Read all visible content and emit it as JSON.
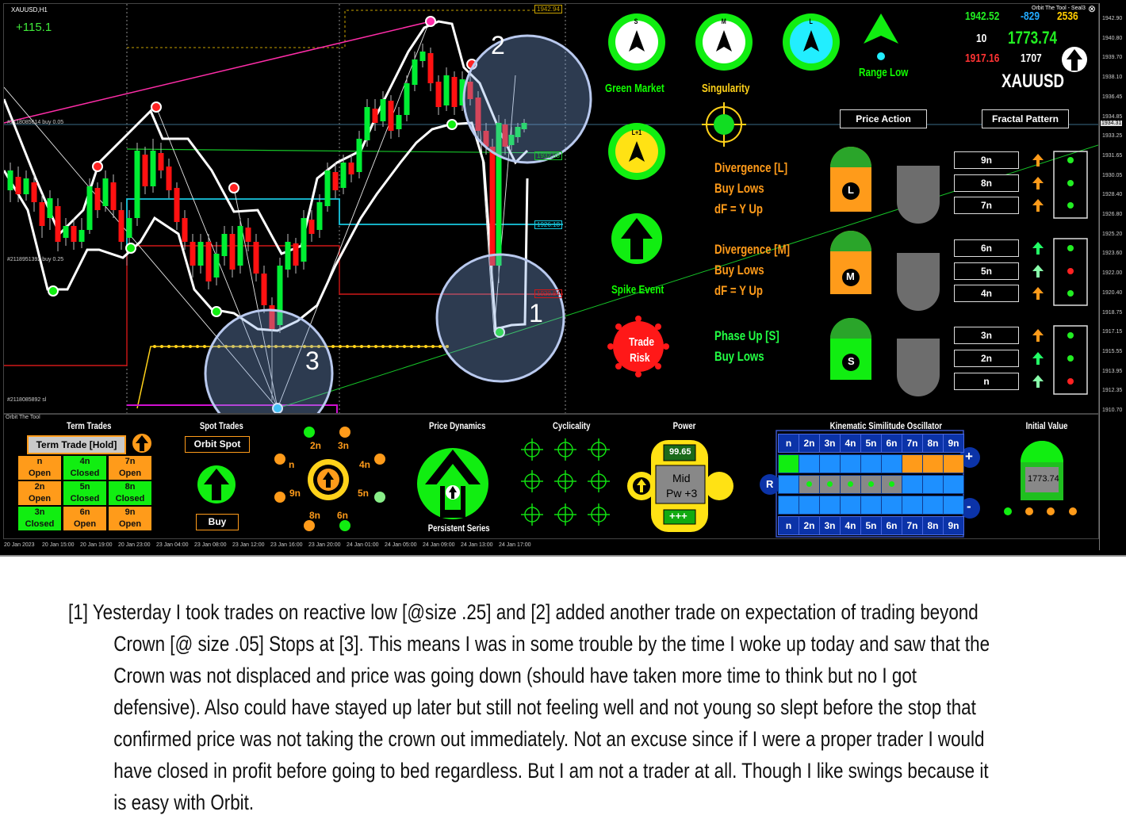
{
  "window": {
    "title": "XAUUSD,H1",
    "profit": "+115.1",
    "indicator_name": "Orbit The Tool - Seal3",
    "close_glyph": "⊗"
  },
  "orders": {
    "buy_05": "#2118085614 buy 0.05",
    "buy_25": "#2118951392 buy 0.25",
    "sl": "#2118085892 sl"
  },
  "level_tags": {
    "top": "1942.94",
    "mid1": "1932.58",
    "cyan": "1926.18",
    "red": "1920.84",
    "bid": "1934.31"
  },
  "chart_numbers": [
    "1",
    "2",
    "3"
  ],
  "signals": {
    "s_dial": "S",
    "m_dial": "M",
    "l_dial": "L",
    "lplus_dial": "L+1",
    "green_market": "Green Market",
    "singularity": "Singularity",
    "range_low": "Range Low",
    "spike_event": "Spike Event",
    "trade_risk_line1": "Trade",
    "trade_risk_line2": "Risk"
  },
  "quote": {
    "v1": "1942.52",
    "v2": "-829",
    "v3": "2536",
    "v4": "10",
    "price": "1773.74",
    "v5": "1917.16",
    "v6": "1707",
    "symbol": "XAUUSD"
  },
  "header_buttons": {
    "price_action": "Price Action",
    "fractal_pattern": "Fractal Pattern"
  },
  "divergences": [
    {
      "badge": "L",
      "lines": [
        "Divergence [L]",
        "Buy Lows",
        "dF = Y Up"
      ]
    },
    {
      "badge": "M",
      "lines": [
        "Divergence [M]",
        "Buy Lows",
        "dF = Y Up"
      ]
    },
    {
      "badge": "S",
      "lines": [
        "Phase Up [S]",
        "Buy Lows"
      ]
    }
  ],
  "fractal_rows": [
    "9n",
    "8n",
    "7n",
    "6n",
    "5n",
    "4n",
    "3n",
    "2n",
    "n"
  ],
  "price_scale": [
    "1942.90",
    "1940.80",
    "1939.70",
    "1938.10",
    "1936.45",
    "1934.85",
    "1933.25",
    "1931.65",
    "1930.05",
    "1928.40",
    "1926.80",
    "1925.20",
    "1923.60",
    "1922.00",
    "1920.40",
    "1918.75",
    "1917.15",
    "1915.55",
    "1913.95",
    "1912.35",
    "1910.70"
  ],
  "time_axis": [
    "20 Jan 2023",
    "20 Jan 15:00",
    "20 Jan 19:00",
    "20 Jan 23:00",
    "23 Jan 04:00",
    "23 Jan 08:00",
    "23 Jan 12:00",
    "23 Jan 16:00",
    "23 Jan 20:00",
    "24 Jan 01:00",
    "24 Jan 05:00",
    "24 Jan 09:00",
    "24 Jan 13:00",
    "24 Jan 17:00"
  ],
  "lower": {
    "subtitle": "Orbit The Tool",
    "term_trades": "Term Trades",
    "term_trade_hold": "Term Trade [Hold]",
    "term_cells": [
      [
        "n",
        "Open"
      ],
      [
        "4n",
        "Closed"
      ],
      [
        "7n",
        "Open"
      ],
      [
        "2n",
        "Open"
      ],
      [
        "5n",
        "Closed"
      ],
      [
        "8n",
        "Closed"
      ],
      [
        "3n",
        "Closed"
      ],
      [
        "6n",
        "Open"
      ],
      [
        "9n",
        "Open"
      ]
    ],
    "spot_trades": "Spot Trades",
    "orbit_spot": "Orbit Spot",
    "buy": "Buy",
    "orbit_ring": [
      "2n",
      "3n",
      "n",
      "4n",
      "9n",
      "5n",
      "8n",
      "6n"
    ],
    "price_dynamics": "Price Dynamics",
    "persistent_series": "Persistent Series",
    "cyclicality": "Cyclicality",
    "power": "Power",
    "power_value": "99.65",
    "power_mid": "Mid",
    "power_pw": "Pw +3",
    "power_plus": "+++",
    "kso": "Kinematic Similitude Oscillator",
    "kso_labels": [
      "n",
      "2n",
      "3n",
      "4n",
      "5n",
      "6n",
      "7n",
      "8n",
      "9n"
    ],
    "kso_r": "R",
    "kso_plus": "+",
    "kso_minus": "-",
    "initial_value": "Initial Value",
    "initial_number": "1773.74"
  },
  "caption": {
    "line1": "[1] Yesterday I took trades on reactive low [@size .25] and [2] added another trade on expectation of trading beyond",
    "lines": [
      "Crown [@ size .05] Stops at [3]. This means I was in some trouble by the time I woke up today and saw that the",
      "Crown was not displaced and price was going down (should have taken more time to think but no I got",
      "defensive). Also could have stayed up later but still not feeling well and not young so slept before the stop that",
      "confirmed price was not taking the crown out immediately. Not an excuse since if I were a proper trader I would",
      "have closed in profit before going to bed regardless. But I am not a trader at all. Though I like swings because it",
      "is easy with Orbit."
    ]
  },
  "colors": {
    "bull": "#00ee33",
    "bear": "#ff1111",
    "orange": "#ff9b1a",
    "panel": "#000000",
    "blue_cell": "#1e90ff",
    "kso_frame": "#0b33a8"
  }
}
